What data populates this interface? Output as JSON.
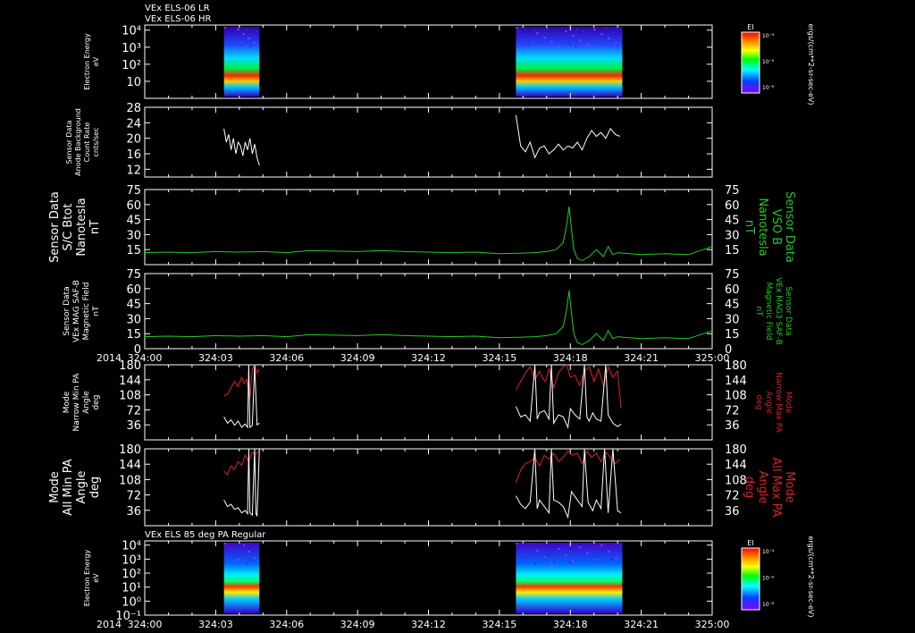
{
  "header": {
    "title_lr": "VEx ELS-06 LR",
    "title_hr": "VEx ELS-06 HR"
  },
  "colors": {
    "white": "#ffffff",
    "green": "#22cc22",
    "red": "#dd2222",
    "background": "#000000"
  },
  "chart_data": [
    {
      "id": "p1",
      "type": "heatmap",
      "title": "VEx ELS-06 LR / VEx ELS-06 HR",
      "ylabel": [
        "Electron Energy",
        "eV"
      ],
      "ylim": [
        1,
        20000
      ],
      "yscale": "log",
      "yticks": [
        "10⁴",
        "10³",
        "10²",
        "10"
      ],
      "x_segments": [
        [
          3.35,
          4.85
        ],
        [
          15.7,
          20.2
        ]
      ],
      "colorbar": {
        "label": "EI",
        "ticks": [
          "10⁻⁴",
          "10⁻⁶",
          "10⁻⁸"
        ],
        "unit": "ergs/(cm**2-sr-sec-eV)"
      }
    },
    {
      "id": "p2",
      "type": "line",
      "ylabel": [
        "Sensor Data",
        "Anode Background",
        "Count Rate",
        "cnts/sec"
      ],
      "ylim": [
        10,
        28
      ],
      "yticks": [
        28,
        24,
        20,
        16,
        12
      ],
      "series": [
        {
          "color": "white",
          "segments": [
            {
              "x": [
                3.35,
                3.45,
                3.55,
                3.65,
                3.75,
                3.85,
                3.95,
                4.05,
                4.15,
                4.25,
                4.35,
                4.45,
                4.55,
                4.65,
                4.75,
                4.85
              ],
              "y": [
                22.5,
                19,
                21,
                17,
                20,
                16,
                19,
                18,
                15.5,
                19,
                17,
                20,
                16,
                18.5,
                15,
                13
              ]
            },
            {
              "x": [
                15.7,
                15.9,
                16.1,
                16.3,
                16.5,
                16.7,
                16.9,
                17.1,
                17.3,
                17.5,
                17.7,
                17.9,
                18.1,
                18.3,
                18.5,
                18.7,
                18.9,
                19.1,
                19.3,
                19.5,
                19.7,
                19.9,
                20.1
              ],
              "y": [
                26,
                18,
                16.5,
                19,
                15,
                17.5,
                18,
                16,
                17,
                18.5,
                17,
                18,
                17.5,
                19,
                17,
                20,
                22,
                20.5,
                21.5,
                20,
                22.5,
                21,
                20.5
              ]
            }
          ]
        }
      ]
    },
    {
      "id": "p3",
      "type": "line",
      "ylabel": [
        "Sensor Data",
        "S/C Btot",
        "Nanotesla",
        "nT"
      ],
      "ylabel_right": [
        "Sensor Data",
        "VSO B",
        "Nanotesla",
        "nT"
      ],
      "ylim": [
        0,
        75
      ],
      "yticks": [
        75,
        60,
        45,
        30,
        15
      ],
      "series": [
        {
          "color": "green",
          "segments": [
            {
              "x": [
                0,
                1,
                2,
                3,
                4,
                5,
                6,
                7,
                8,
                9,
                10,
                11,
                12,
                13,
                14,
                15,
                16,
                16.5,
                17,
                17.4,
                17.7,
                17.85,
                17.95,
                18.05,
                18.15,
                18.3,
                18.5,
                18.8,
                19.1,
                19.4,
                19.6,
                19.8,
                20,
                20.5,
                21,
                22,
                23,
                23.5,
                24
              ],
              "y": [
                12,
                12.5,
                12,
                13,
                12.5,
                13,
                12,
                14,
                13.5,
                13,
                14,
                13,
                12.5,
                12,
                12.5,
                11,
                11.5,
                12,
                13,
                15,
                22,
                40,
                58,
                35,
                15,
                6,
                4,
                8,
                15,
                8,
                18,
                10,
                12,
                11,
                10,
                11,
                10,
                14,
                18
              ]
            }
          ]
        }
      ]
    },
    {
      "id": "p4",
      "type": "line",
      "ylabel": [
        "Sensor Data",
        "VEx MAG SAF-B",
        "Magnetic Field",
        "nT"
      ],
      "ylabel_right": [
        "Sensor Data",
        "VEx MAG3 SAF-B",
        "Magnetic Field",
        "nT"
      ],
      "ylim": [
        0,
        75
      ],
      "yticks": [
        75,
        60,
        45,
        30,
        15,
        0
      ],
      "series": [
        {
          "color": "green",
          "segments": [
            {
              "x": [
                0,
                1,
                2,
                3,
                4,
                5,
                6,
                7,
                8,
                9,
                10,
                11,
                12,
                13,
                14,
                15,
                16,
                16.5,
                17,
                17.4,
                17.7,
                17.85,
                17.95,
                18.05,
                18.15,
                18.3,
                18.5,
                18.8,
                19.1,
                19.4,
                19.6,
                19.8,
                20,
                20.5,
                21,
                22,
                23,
                23.5,
                24
              ],
              "y": [
                12,
                12.5,
                12,
                13,
                12.5,
                13,
                12,
                14,
                13.5,
                13,
                14,
                13,
                12.5,
                12,
                12.5,
                11,
                11.5,
                12,
                13,
                15,
                22,
                40,
                58,
                35,
                15,
                6,
                4,
                8,
                15,
                8,
                18,
                10,
                12,
                11,
                10,
                11,
                10,
                14,
                18
              ]
            }
          ]
        }
      ]
    },
    {
      "id": "p5",
      "type": "line",
      "ylabel": [
        "Mode",
        "Narrow Min PA",
        "Angle",
        "deg"
      ],
      "ylabel_right": [
        "Mode",
        "Narrow Max PA",
        "Angle",
        "deg"
      ],
      "ylim": [
        0,
        180
      ],
      "yticks": [
        180,
        144,
        108,
        72,
        36
      ],
      "series": [
        {
          "color": "red",
          "segments": [
            {
              "x": [
                3.35,
                3.5,
                3.65,
                3.8,
                3.95,
                4.1,
                4.2,
                4.3,
                4.45,
                4.55,
                4.65,
                4.75,
                4.85
              ],
              "y": [
                105,
                110,
                125,
                140,
                128,
                150,
                135,
                145,
                100,
                170,
                180,
                160,
                170
              ]
            },
            {
              "x": [
                15.7,
                15.9,
                16.1,
                16.3,
                16.5,
                16.7,
                16.8,
                16.95,
                17.1,
                17.3,
                17.5,
                17.7,
                17.85,
                18,
                18.2,
                18.4,
                18.6,
                18.8,
                19,
                19.2,
                19.4,
                19.6,
                19.8,
                20,
                20.15
              ],
              "y": [
                120,
                140,
                160,
                175,
                145,
                165,
                150,
                140,
                170,
                125,
                160,
                175,
                180,
                150,
                155,
                130,
                165,
                175,
                140,
                170,
                130,
                175,
                150,
                165,
                75
              ]
            }
          ]
        },
        {
          "color": "white",
          "segments": [
            {
              "x": [
                3.35,
                3.5,
                3.65,
                3.8,
                3.95,
                4.1,
                4.25,
                4.35,
                4.4,
                4.45,
                4.55,
                4.65,
                4.75,
                4.85
              ],
              "y": [
                55,
                40,
                48,
                35,
                45,
                30,
                38,
                30,
                180,
                30,
                35,
                180,
                36,
                40
              ]
            },
            {
              "x": [
                15.7,
                15.9,
                16.1,
                16.3,
                16.5,
                16.6,
                16.7,
                16.9,
                17.1,
                17.2,
                17.3,
                17.5,
                17.7,
                17.9,
                18,
                18.2,
                18.4,
                18.6,
                18.7,
                18.8,
                18.95,
                19.1,
                19.3,
                19.5,
                19.6,
                19.8,
                20,
                20.15
              ],
              "y": [
                80,
                55,
                60,
                45,
                180,
                50,
                65,
                70,
                50,
                180,
                40,
                60,
                55,
                30,
                75,
                60,
                50,
                180,
                55,
                45,
                65,
                50,
                45,
                180,
                60,
                40,
                32,
                38
              ]
            }
          ]
        }
      ]
    },
    {
      "id": "p6",
      "type": "line",
      "ylabel": [
        "Mode",
        "All Min PA",
        "Angle",
        "deg"
      ],
      "ylabel_right": [
        "Mode",
        "All Max PA",
        "Angle",
        "deg"
      ],
      "ylim": [
        0,
        180
      ],
      "yticks": [
        180,
        144,
        108,
        72,
        36
      ],
      "series": [
        {
          "color": "red",
          "segments": [
            {
              "x": [
                3.35,
                3.5,
                3.65,
                3.8,
                3.95,
                4.1,
                4.25,
                4.4,
                4.55,
                4.7,
                4.85
              ],
              "y": [
                128,
                120,
                140,
                132,
                150,
                142,
                165,
                150,
                172,
                168,
                175
              ]
            },
            {
              "x": [
                15.7,
                15.9,
                16.1,
                16.3,
                16.5,
                16.7,
                16.9,
                17.1,
                17.3,
                17.5,
                17.7,
                17.9,
                18.1,
                18.3,
                18.5,
                18.7,
                18.9,
                19.1,
                19.3,
                19.5,
                19.7,
                19.9,
                20.1
              ],
              "y": [
                100,
                130,
                145,
                150,
                160,
                140,
                165,
                155,
                170,
                150,
                160,
                175,
                165,
                170,
                145,
                175,
                160,
                170,
                150,
                172,
                160,
                145,
                155
              ]
            }
          ]
        },
        {
          "color": "white",
          "segments": [
            {
              "x": [
                3.35,
                3.5,
                3.65,
                3.8,
                3.95,
                4.1,
                4.25,
                4.35,
                4.4,
                4.45,
                4.55,
                4.65,
                4.7,
                4.75,
                4.85
              ],
              "y": [
                60,
                45,
                50,
                38,
                42,
                30,
                36,
                28,
                180,
                30,
                25,
                180,
                30,
                22,
                180
              ]
            },
            {
              "x": [
                15.7,
                15.9,
                16.1,
                16.3,
                16.5,
                16.6,
                16.7,
                16.9,
                17.1,
                17.2,
                17.3,
                17.5,
                17.7,
                17.9,
                18.05,
                18.3,
                18.5,
                18.6,
                18.75,
                18.95,
                19.1,
                19.3,
                19.45,
                19.6,
                19.8,
                20,
                20.15
              ],
              "y": [
                70,
                50,
                40,
                55,
                180,
                40,
                60,
                45,
                30,
                180,
                60,
                55,
                45,
                20,
                80,
                60,
                45,
                180,
                55,
                35,
                60,
                40,
                180,
                30,
                180,
                35,
                30
              ]
            }
          ]
        }
      ]
    },
    {
      "id": "p7",
      "type": "heatmap",
      "title": "VEx ELS 85 deg PA Regular",
      "ylabel": [
        "Electron Energy",
        "eV"
      ],
      "ylim": [
        0.1,
        20000
      ],
      "yscale": "log",
      "yticks": [
        "10⁴",
        "10³",
        "10²",
        "10¹",
        "10⁰",
        "10⁻¹"
      ],
      "x_segments": [
        [
          3.35,
          4.85
        ],
        [
          15.7,
          20.2
        ]
      ],
      "colorbar": {
        "label": "EI",
        "ticks": [
          "10⁻⁴",
          "10⁻⁶",
          "10⁻⁸"
        ],
        "unit": "ergs/(cm**2-sr-sec-eV)"
      }
    }
  ],
  "time_axis": {
    "year_label": "2014",
    "ticks": [
      "324:00",
      "324:03",
      "324:06",
      "324:09",
      "324:12",
      "324:15",
      "324:18",
      "324:21",
      "325:00"
    ],
    "xlim": [
      0,
      24
    ]
  }
}
